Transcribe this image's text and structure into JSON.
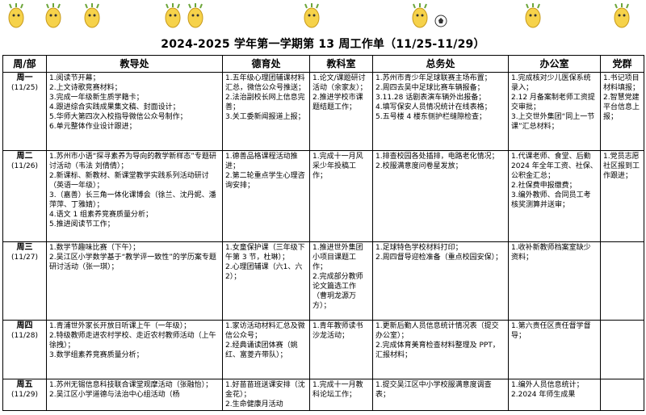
{
  "title": "2024-2025 学年第一学期第 13 周工作单（11/25-11/29）",
  "headers": [
    "周/部",
    "教导处",
    "德育处",
    "教科室",
    "总务处",
    "办公室",
    "党群"
  ],
  "rows": [
    {
      "day": "周一",
      "date": "(11/25)",
      "cells": [
        [
          "1.阅读节开幕；",
          "2.上文诗歌竞赛材料；",
          "3.完成一年级新生质学籍卡；",
          "4.跟进综合实践成果集文稿、封面设计；",
          "5.华师大第四次入校指导微信公众号制作；",
          "6.单元整体作业设计跟进；"
        ],
        [
          "1.五年级心理团辅课材料汇总，微信公众号推送；",
          "2.法治副校长网上信息完善；",
          "3.关工委新闻报道上报；"
        ],
        [
          "1.论文/课题研讨活动（余家友）；",
          "2.推进学校市课题结题工作；"
        ],
        [
          "1.苏州市青少年足球联赛主场布置；",
          "2.周四去吴中足球比赛车辆报备；",
          "3.11.28 话剧表演车辆外出报备；",
          "4.填写保安人员情况统计在线表格；",
          "5.五号楼 4 楼东侧护栏缝隙检查；"
        ],
        [
          "1.完成核对少儿医保系统录入；",
          "2.12 月备案制老师工资提交审批；",
          "3.上交世外集团“同上一节课”汇总材料；"
        ],
        [
          "1.书记项目材料填报；",
          "2.智慧党建平台信息上报；"
        ]
      ]
    },
    {
      "day": "周二",
      "date": "(11/26)",
      "cells": [
        [
          "1.苏州市小语“探寻素养为导向的教学新样态”专题研讨活动（韦法 刘倩倩）；",
          "2.新课标、新教材、新课堂教学实践系列活动研讨（英语一年级）；",
          "3.（嘉善）长三角一体化课博会（徐兰、沈丹妮、潘萍萍、丁雅婧）；",
          "4.语文 1 组素养竞赛质量分析；",
          "5.推进阅读节工作；"
        ],
        [
          "1.德善品格课程活动推进；",
          "2.第二轮重点学生心理咨询安排；"
        ],
        [
          "1.完成十一月风采少年投稿工作；"
        ],
        [
          "1.排查校园各处插排，电路老化情况；",
          "2.校服满意度问卷星发放；"
        ],
        [
          "1.代课老师、食堂、后勤 2024 年全年工资、社保、公积金汇总；",
          "2.社保费申报缴费；",
          "3.编外教师、合同员工考核奖测算并送审；"
        ],
        [
          "1.党员志愿社区报到工作跟进；"
        ]
      ]
    },
    {
      "day": "周三",
      "date": "(11/27)",
      "cells": [
        [
          "1.数学节趣味比赛（下午）；",
          "2.吴江区小学数学基于“教学评一致性”的学历案专题研讨活动（张一琪）；"
        ],
        [
          "1.女童保护课（三年级下午第 3 节，杜琳）；",
          "2.心理团辅课（六1、六2）；"
        ],
        [
          "1.推进世外集团小项目课题工作；",
          "2.完成部分教师论文篇选工作（曹玥龙源万方）；"
        ],
        [
          "1.足球特色学校材料打印；",
          "2.周四督导迎检准备（重点校园安保）；"
        ],
        [
          "1.收补新教师档案室缺少资料；"
        ],
        []
      ]
    },
    {
      "day": "周四",
      "date": "(11/28)",
      "cells": [
        [
          "1.青浦世外家长开放日听课上午（一年级）；",
          "2.特级教师走进农村学校、走近农村教师活动（上午徐拽）；",
          "3.数学组素养竞赛质量分析；"
        ],
        [
          "1.家访活动材料汇总及微信公众号；",
          "2.经典诵读团体赛（姚红、富菱卉带队）；"
        ],
        [
          "1.青年教师读书沙龙活动；"
        ],
        [
          "1.更新后勤人员信息统计情况表（提交办公室）；",
          "2.完成体育美育检查材料整理及 PPT，汇报材料；"
        ],
        [
          "1.第六责任区责任督学督导；"
        ],
        []
      ]
    },
    {
      "day": "周五",
      "date": "(11/29)",
      "cells": [
        [
          "1.苏州无锡信息科技联合课堂观摩活动（张融怡）；",
          "2.吴江区小学道德与法治中心组活动（杨"
        ],
        [
          "1.好苗苗班送课安排（沈金花）；",
          "2.生命健康月活动"
        ],
        [
          "1.完成十一月教科论坛工作；"
        ],
        [
          "1.提交吴江区中小学校服满意度调查表；"
        ],
        [
          "1.编外人员信息统计；",
          "2.2024 年师生成果"
        ],
        []
      ]
    }
  ],
  "colors": {
    "border": "#000000",
    "underline": "#2e6fd1"
  }
}
